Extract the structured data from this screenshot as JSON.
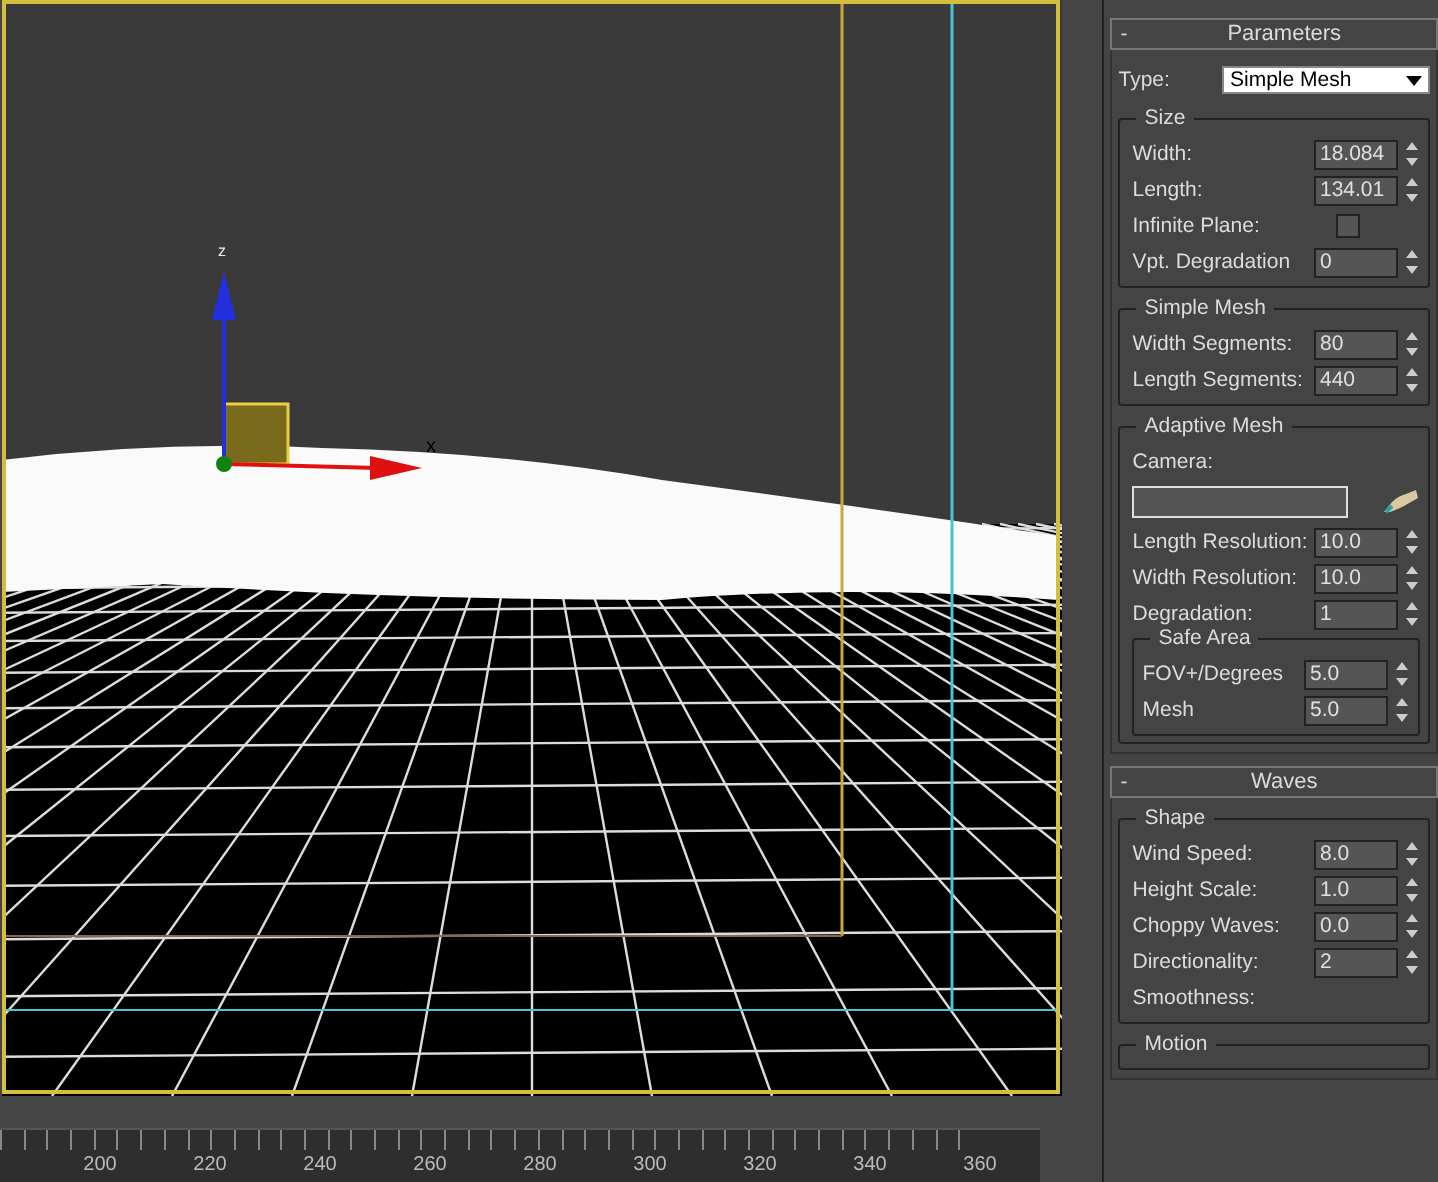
{
  "viewport": {
    "gizmo_labels": [
      "z",
      "x"
    ]
  },
  "time_ruler": {
    "ticks": [
      "200",
      "220",
      "240",
      "260",
      "280",
      "300",
      "320",
      "340",
      "360"
    ]
  },
  "rollouts": [
    {
      "title": "Parameters",
      "collapse": "-",
      "top": [
        {
          "kind": "dropdown",
          "label": "Type:",
          "value": "Simple Mesh"
        }
      ],
      "groups": [
        {
          "title": "Size",
          "rows": [
            {
              "kind": "spinner",
              "label": "Width:",
              "value": "18.084"
            },
            {
              "kind": "spinner",
              "label": "Length:",
              "value": "134.01"
            },
            {
              "kind": "checkbox",
              "label": "Infinite Plane:",
              "checked": false
            },
            {
              "kind": "spinner",
              "label": "Vpt. Degradation",
              "value": "0"
            }
          ]
        },
        {
          "title": "Simple Mesh",
          "rows": [
            {
              "kind": "spinner",
              "label": "Width Segments:",
              "value": "80"
            },
            {
              "kind": "spinner",
              "label": "Length Segments:",
              "value": "440"
            }
          ]
        },
        {
          "title": "Adaptive Mesh",
          "rows": [
            {
              "kind": "picker",
              "label": "Camera:"
            },
            {
              "kind": "spinner",
              "label": "Length Resolution:",
              "value": "10.0"
            },
            {
              "kind": "spinner",
              "label": "Width Resolution:",
              "value": "10.0"
            },
            {
              "kind": "spinner",
              "label": "Degradation:",
              "value": "1"
            }
          ],
          "groups": [
            {
              "title": "Safe Area",
              "rows": [
                {
                  "kind": "spinner",
                  "label": "FOV+/Degrees",
                  "value": "5.0"
                },
                {
                  "kind": "spinner",
                  "label": "Mesh",
                  "value": "5.0"
                }
              ]
            }
          ]
        }
      ]
    },
    {
      "title": "Waves",
      "collapse": "-",
      "groups": [
        {
          "title": "Shape",
          "rows": [
            {
              "kind": "spinner",
              "label": "Wind Speed:",
              "value": "8.0"
            },
            {
              "kind": "spinner",
              "label": "Height Scale:",
              "value": "1.0"
            },
            {
              "kind": "spinner",
              "label": "Choppy Waves:",
              "value": "0.0"
            },
            {
              "kind": "spinner",
              "label": "Directionality:",
              "value": "2"
            },
            {
              "kind": "label",
              "label": "Smoothness:"
            }
          ]
        },
        {
          "title": "Motion"
        }
      ]
    }
  ]
}
